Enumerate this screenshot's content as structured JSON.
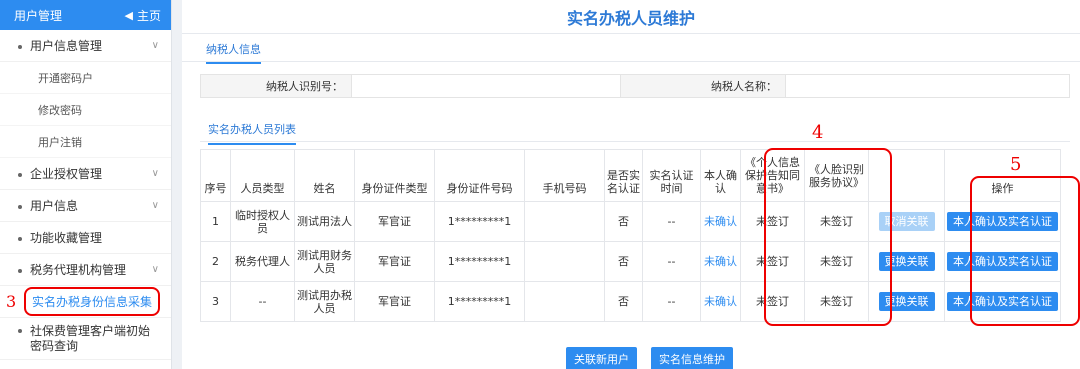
{
  "sidebar": {
    "title": "用户管理",
    "home_label": "主页",
    "items": [
      {
        "label": "用户信息管理",
        "expandable": true
      },
      {
        "label": "开通密码户",
        "sub": true
      },
      {
        "label": "修改密码",
        "sub": true
      },
      {
        "label": "用户注销",
        "sub": true
      },
      {
        "label": "企业授权管理",
        "expandable": true
      },
      {
        "label": "用户信息",
        "expandable": true
      },
      {
        "label": "功能收藏管理",
        "expandable": false
      },
      {
        "label": "税务代理机构管理",
        "expandable": true
      },
      {
        "label": "实名办税身份信息采集",
        "active": true
      },
      {
        "label": "社保费管理客户端初始密码查询",
        "expandable": false
      }
    ]
  },
  "main": {
    "title": "实名办税人员维护",
    "tab_label": "纳税人信息",
    "filter": {
      "id_label": "纳税人识别号：",
      "name_label": "纳税人名称："
    },
    "list_tab": "实名办税人员列表",
    "table": {
      "headers": [
        "序号",
        "人员类型",
        "姓名",
        "身份证件类型",
        "身份证件号码",
        "手机号码",
        "是否实名认证",
        "实名认证时间",
        "本人确认",
        "《个人信息保护告知同意书》",
        "《人脸识别服务协议》",
        "",
        "操作"
      ],
      "rows": [
        {
          "no": "1",
          "type": "临时授权人员",
          "name": "测试用法人",
          "id_type": "军官证",
          "id_no": "1*********1",
          "phone": "",
          "verified": "否",
          "verify_time": "--",
          "confirm": "未确认",
          "privacy": "未签订",
          "face": "未签订",
          "action1": "取消关联",
          "action1_disabled": true,
          "action2": "本人确认及实名认证"
        },
        {
          "no": "2",
          "type": "税务代理人",
          "name": "测试用财务人员",
          "id_type": "军官证",
          "id_no": "1*********1",
          "phone": "",
          "verified": "否",
          "verify_time": "--",
          "confirm": "未确认",
          "privacy": "未签订",
          "face": "未签订",
          "action1": "更换关联",
          "action1_disabled": false,
          "action2": "本人确认及实名认证"
        },
        {
          "no": "3",
          "type": "--",
          "name": "测试用办税人员",
          "id_type": "军官证",
          "id_no": "1*********1",
          "phone": "",
          "verified": "否",
          "verify_time": "--",
          "confirm": "未确认",
          "privacy": "未签订",
          "face": "未签订",
          "action1": "更换关联",
          "action1_disabled": false,
          "action2": "本人确认及实名认证"
        }
      ]
    },
    "buttons": {
      "link_new": "关联新用户",
      "maintain": "实名信息维护"
    }
  },
  "annotations": {
    "n3": "3",
    "n4": "4",
    "n5": "5"
  },
  "colors": {
    "accent": "#2d8cf0",
    "highlight": "#ee0000"
  }
}
